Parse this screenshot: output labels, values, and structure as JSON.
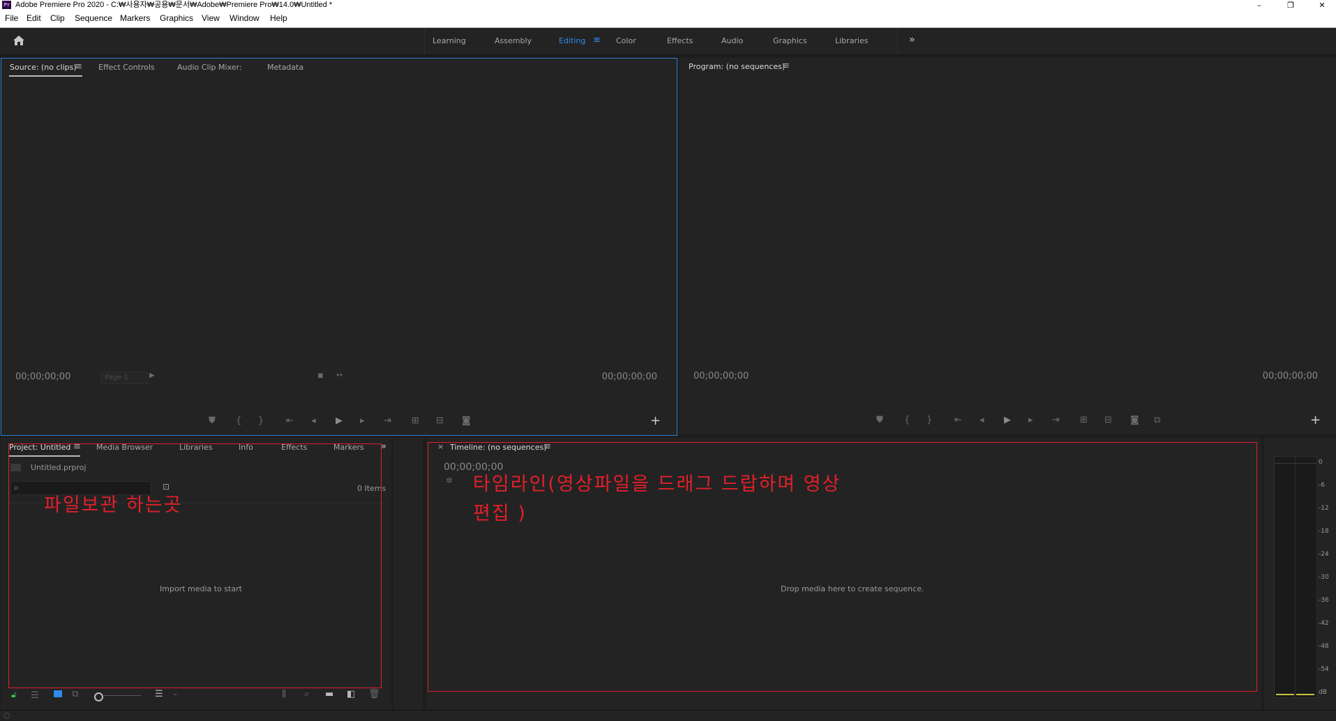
{
  "window": {
    "app_icon_text": "Pr",
    "title": "Adobe Premiere Pro 2020 - C:₩사용자₩공용₩문서₩Adobe₩Premiere Pro₩14.0₩Untitled *",
    "minimize": "–",
    "restore": "❐",
    "close": "✕"
  },
  "menu": [
    "File",
    "Edit",
    "Clip",
    "Sequence",
    "Markers",
    "Graphics",
    "View",
    "Window",
    "Help"
  ],
  "workspaces": {
    "tabs": [
      "Learning",
      "Assembly",
      "Editing",
      "Color",
      "Effects",
      "Audio",
      "Graphics",
      "Libraries"
    ],
    "active": "Editing",
    "menu_icon": "≡",
    "overflow": "»"
  },
  "source_panel": {
    "tabs": [
      "Source: (no clips)",
      "Effect Controls",
      "Audio Clip Mixer:",
      "Metadata"
    ],
    "tab_menu": "≡",
    "timecode_left": "00;00;00;00",
    "page_select": "Page 1",
    "timecode_right": "00;00;00;00",
    "add_button": "+"
  },
  "program_panel": {
    "tab": "Program: (no sequences)",
    "tab_menu": "≡",
    "timecode_left": "00;00;00;00",
    "timecode_right": "00;00;00;00",
    "add_button": "+"
  },
  "project_panel": {
    "tabs": [
      "Project: Untitled",
      "Media Browser",
      "Libraries",
      "Info",
      "Effects",
      "Markers"
    ],
    "tab_menu": "≡",
    "overflow": "»",
    "file_name": "Untitled.prproj",
    "items_count": "0 Items",
    "search_placeholder": "",
    "empty_hint": "Import media to start",
    "annotation": "파일보관 하는곳"
  },
  "timeline_panel": {
    "close": "×",
    "tab": "Timeline: (no sequences)",
    "tab_menu": "≡",
    "timecode": "00;00;00;00",
    "empty_hint": "Drop media here to create sequence.",
    "annotation_line1": "타임라인(영상파일을 드래그 드랍하며 영상",
    "annotation_line2": "편집 )"
  },
  "audio_meter": {
    "labels": [
      "0",
      "-6",
      "-12",
      "-18",
      "-24",
      "-30",
      "-36",
      "-42",
      "-48",
      "-54",
      "dB"
    ]
  },
  "colors": {
    "accent": "#2d8ceb",
    "annotation_red": "#e0202a",
    "panel_bg": "#232323",
    "app_bg": "#1d1d1d"
  }
}
